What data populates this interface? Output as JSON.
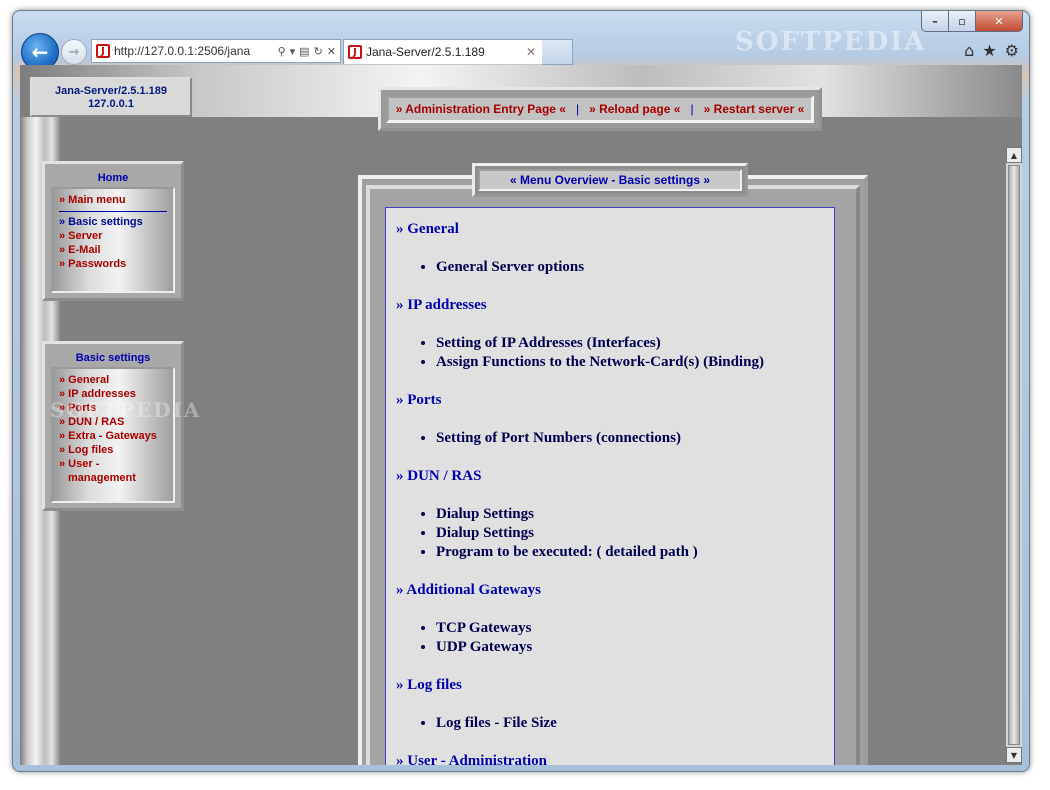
{
  "browser": {
    "watermark": "SOFTPEDIA",
    "address": "http://127.0.0.1:2506/jana",
    "tab_title": "Jana-Server/2.5.1.189",
    "back_icon": "back-arrow-icon",
    "forward_icon": "forward-arrow-icon",
    "window_buttons": [
      "minimize",
      "maximize",
      "close"
    ]
  },
  "server": {
    "name": "Jana-Server/2.5.1.189",
    "ip": "127.0.0.1"
  },
  "topnav": {
    "admin": "» Administration Entry Page «",
    "reload": "» Reload page «",
    "restart": "» Restart server «"
  },
  "home_panel": {
    "title": "Home",
    "main_menu": "» Main menu",
    "links": [
      "» Basic settings",
      "» Server",
      "» E-Mail",
      "» Passwords"
    ]
  },
  "basic_panel": {
    "title": "Basic settings",
    "links": [
      "» General",
      "» IP addresses",
      "» Ports",
      "» DUN / RAS",
      "» Extra - Gateways",
      "» Log files",
      "» User - management"
    ]
  },
  "overview_title": "« Menu Overview - Basic settings »",
  "sections": [
    {
      "title": "» General",
      "items": [
        "General Server options"
      ]
    },
    {
      "title": "» IP addresses",
      "items": [
        "Setting of IP Addresses (Interfaces)",
        "Assign Functions to the Network-Card(s) (Binding)"
      ]
    },
    {
      "title": "» Ports",
      "items": [
        "Setting of Port Numbers (connections)"
      ]
    },
    {
      "title": "» DUN / RAS",
      "items": [
        "Dialup Settings",
        "Dialup Settings",
        "Program to be executed: ( detailed path )"
      ]
    },
    {
      "title": "» Additional Gateways",
      "items": [
        "TCP Gateways",
        "UDP Gateways"
      ]
    },
    {
      "title": "» Log files",
      "items": [
        "Log files - File Size"
      ]
    },
    {
      "title": "» User - Administration",
      "items": []
    }
  ]
}
